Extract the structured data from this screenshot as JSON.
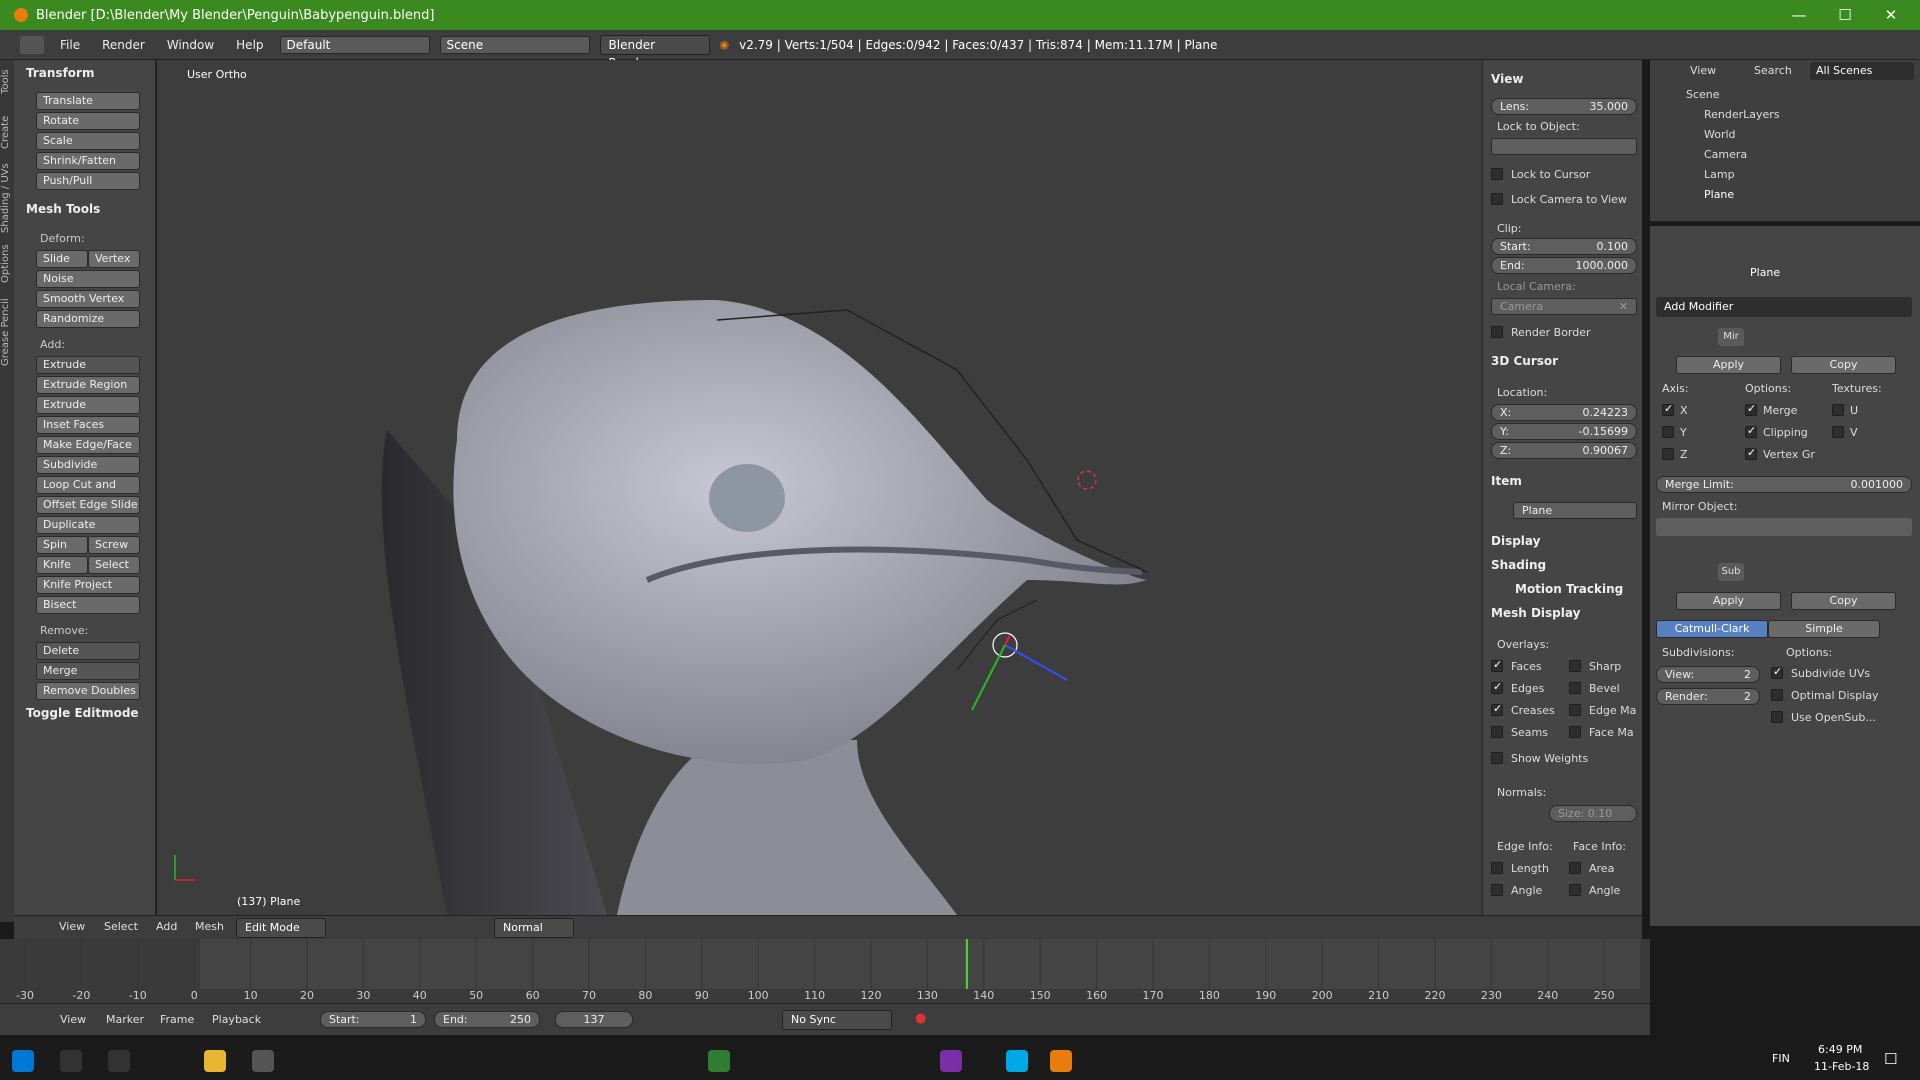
{
  "window": {
    "title": "Blender [D:\\Blender\\My Blender\\Penguin\\Babypenguin.blend]"
  },
  "menubar": {
    "items": [
      "File",
      "Render",
      "Window",
      "Help"
    ],
    "layout": "Default",
    "scene": "Scene",
    "engine": "Blender Render",
    "stats": "v2.79 | Verts:1/504 | Edges:0/942 | Faces:0/437 | Tris:874 | Mem:11.17M | Plane"
  },
  "tabs": [
    "Tools",
    "Create",
    "Shading / UVs",
    "Options",
    "Grease Pencil"
  ],
  "toolshelf": {
    "transform_title": "Transform",
    "transform": [
      "Translate",
      "Rotate",
      "Scale",
      "Shrink/Fatten",
      "Push/Pull"
    ],
    "meshtools_title": "Mesh Tools",
    "deform_label": "Deform:",
    "slide_ed": "Slide Ed",
    "vertex": "Vertex",
    "deform": [
      "Noise",
      "Smooth Vertex",
      "Randomize"
    ],
    "add_label": "Add:",
    "extrude": "Extrude",
    "add": [
      "Extrude Region",
      "Extrude Individual",
      "Inset Faces",
      "Make Edge/Face",
      "Subdivide",
      "Loop Cut and Slide",
      "Offset Edge Slide",
      "Duplicate"
    ],
    "spin": "Spin",
    "screw": "Screw",
    "knife": "Knife",
    "select": "Select",
    "knife_project": "Knife Project",
    "bisect": "Bisect",
    "remove_label": "Remove:",
    "delete": "Delete",
    "merge": "Merge",
    "remove_doubles": "Remove Doubles",
    "toggle": "Toggle Editmode"
  },
  "viewport": {
    "label": "User Ortho",
    "object": "(137) Plane"
  },
  "npanel": {
    "view": "View",
    "lens_label": "Lens:",
    "lens": "35.000",
    "lock_obj": "Lock to Object:",
    "lock_cursor": "Lock to Cursor",
    "lock_camera": "Lock Camera to View",
    "clip": "Clip:",
    "start_label": "Start:",
    "start": "0.100",
    "end_label": "End:",
    "end": "1000.000",
    "local_cam": "Local Camera:",
    "camera": "Camera",
    "render_border": "Render Border",
    "cursor": "3D Cursor",
    "location": "Location:",
    "x": "0.24223",
    "y": "-0.15699",
    "z": "0.90067",
    "item": "Item",
    "item_name": "Plane",
    "display": "Display",
    "shading": "Shading",
    "motion": "Motion Tracking",
    "meshdisplay": "Mesh Display",
    "overlays": "Overlays:",
    "faces": "Faces",
    "edges": "Edges",
    "creases": "Creases",
    "seams": "Seams",
    "sharp": "Sharp",
    "bevel": "Bevel",
    "edgema": "Edge Ma",
    "facema": "Face Ma",
    "weights": "Show Weights",
    "normals": "Normals:",
    "size": "Size: 0.10",
    "edgeinfo": "Edge Info:",
    "faceinfo": "Face Info:",
    "length": "Length",
    "area": "Area",
    "angle": "Angle"
  },
  "outliner": {
    "view": "View",
    "search": "Search",
    "allscenes": "All Scenes",
    "items": [
      "Scene",
      "RenderLayers",
      "World",
      "Camera",
      "Lamp",
      "Plane"
    ]
  },
  "props": {
    "object": "Plane",
    "add_modifier": "Add Modifier",
    "mir": "Mir",
    "apply": "Apply",
    "copy": "Copy",
    "axis": "Axis:",
    "options": "Options:",
    "textures": "Textures:",
    "x": "X",
    "y": "Y",
    "z": "Z",
    "merge": "Merge",
    "clipping": "Clipping",
    "vertexgr": "Vertex Gr",
    "u": "U",
    "v": "V",
    "merge_limit_label": "Merge Limit:",
    "merge_limit": "0.001000",
    "mirror_obj": "Mirror Object:",
    "sub": "Sub",
    "catmull": "Catmull-Clark",
    "simple": "Simple",
    "subdivisions": "Subdivisions:",
    "view_label": "View:",
    "view": "2",
    "render_label": "Render:",
    "render": "2",
    "subdiv_uvs": "Subdivide UVs",
    "optimal": "Optimal Display",
    "opensub": "Use OpenSub..."
  },
  "vpheader": {
    "items": [
      "View",
      "Select",
      "Add",
      "Mesh"
    ],
    "mode": "Edit Mode",
    "pivot": "Normal"
  },
  "timeline": {
    "ticks": [
      "-30",
      "-20",
      "-10",
      "0",
      "10",
      "20",
      "30",
      "40",
      "50",
      "60",
      "70",
      "80",
      "90",
      "100",
      "110",
      "120",
      "130",
      "140",
      "150",
      "160",
      "170",
      "180",
      "190",
      "200",
      "210",
      "220",
      "230",
      "240",
      "250"
    ],
    "current": 137,
    "items": [
      "View",
      "Marker",
      "Frame",
      "Playback"
    ],
    "start": "Start:",
    "start_val": "1",
    "end": "End:",
    "end_val": "250",
    "frame": "137",
    "sync": "No Sync"
  },
  "taskbar": {
    "lang": "FIN",
    "time": "6:49 PM",
    "date": "11-Feb-18"
  }
}
